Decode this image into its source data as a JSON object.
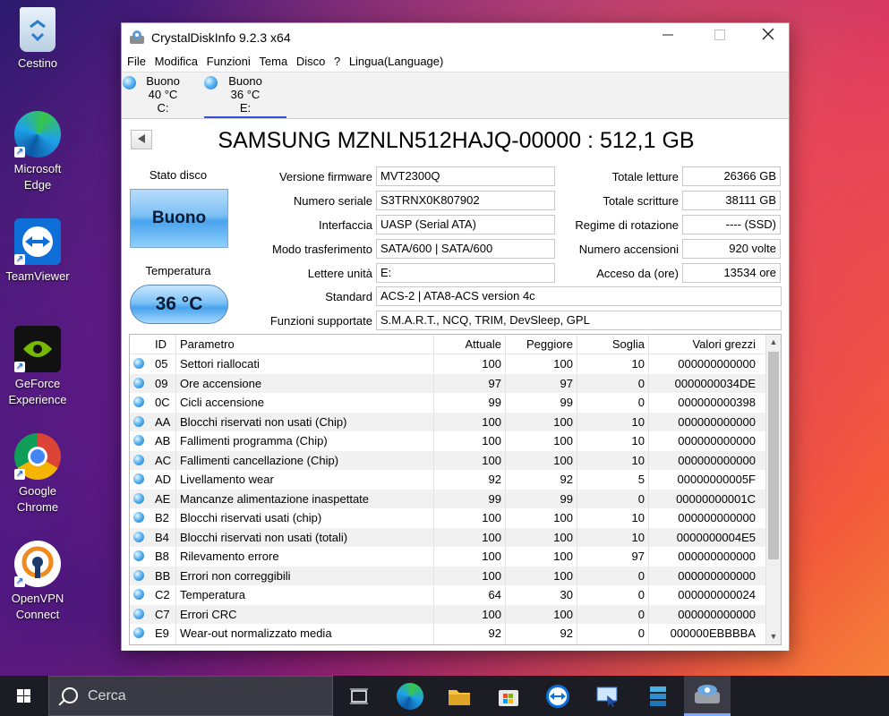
{
  "desktop": {
    "icons": [
      {
        "label": "Cestino"
      },
      {
        "label": "Microsoft Edge"
      },
      {
        "label": "TeamViewer"
      },
      {
        "label": "GeForce Experience"
      },
      {
        "label": "Google Chrome"
      },
      {
        "label": "OpenVPN Connect"
      }
    ]
  },
  "window": {
    "title": "CrystalDiskInfo 9.2.3 x64",
    "menu": [
      "File",
      "Modifica",
      "Funzioni",
      "Tema",
      "Disco",
      "?",
      "Lingua(Language)"
    ],
    "disks": [
      {
        "status": "Buono",
        "temp": "40 °C",
        "drive": "C:"
      },
      {
        "status": "Buono",
        "temp": "36 °C",
        "drive": "E:"
      }
    ],
    "disk_title": "SAMSUNG MZNLN512HAJQ-00000 : 512,1 GB",
    "status_label": "Stato disco",
    "health": "Buono",
    "temp_label": "Temperatura",
    "temp_value": "36 °C",
    "info": {
      "firmware_label": "Versione firmware",
      "firmware": "MVT2300Q",
      "serial_label": "Numero seriale",
      "serial": "S3TRNX0K807902",
      "interface_label": "Interfaccia",
      "interface": "UASP (Serial ATA)",
      "transfer_label": "Modo trasferimento",
      "transfer": "SATA/600 | SATA/600",
      "letters_label": "Lettere unità",
      "letters": "E:",
      "standard_label": "Standard",
      "standard": "ACS-2 | ATA8-ACS version 4c",
      "features_label": "Funzioni supportate",
      "features": "S.M.A.R.T., NCQ, TRIM, DevSleep, GPL",
      "reads_label": "Totale letture",
      "reads": "26366 GB",
      "writes_label": "Totale scritture",
      "writes": "38111 GB",
      "rotation_label": "Regime di rotazione",
      "rotation": "---- (SSD)",
      "power_count_label": "Numero accensioni",
      "power_count": "920 volte",
      "power_hours_label": "Acceso da (ore)",
      "power_hours": "13534 ore"
    },
    "smart": {
      "headers": {
        "id": "ID",
        "name": "Parametro",
        "current": "Attuale",
        "worst": "Peggiore",
        "threshold": "Soglia",
        "raw": "Valori grezzi"
      },
      "rows": [
        {
          "id": "05",
          "name": "Settori riallocati",
          "current": "100",
          "worst": "100",
          "threshold": "10",
          "raw": "000000000000"
        },
        {
          "id": "09",
          "name": "Ore accensione",
          "current": "97",
          "worst": "97",
          "threshold": "0",
          "raw": "0000000034DE"
        },
        {
          "id": "0C",
          "name": "Cicli accensione",
          "current": "99",
          "worst": "99",
          "threshold": "0",
          "raw": "000000000398"
        },
        {
          "id": "AA",
          "name": "Blocchi riservati non usati (Chip)",
          "current": "100",
          "worst": "100",
          "threshold": "10",
          "raw": "000000000000"
        },
        {
          "id": "AB",
          "name": "Fallimenti programma (Chip)",
          "current": "100",
          "worst": "100",
          "threshold": "10",
          "raw": "000000000000"
        },
        {
          "id": "AC",
          "name": "Fallimenti cancellazione (Chip)",
          "current": "100",
          "worst": "100",
          "threshold": "10",
          "raw": "000000000000"
        },
        {
          "id": "AD",
          "name": "Livellamento wear",
          "current": "92",
          "worst": "92",
          "threshold": "5",
          "raw": "00000000005F"
        },
        {
          "id": "AE",
          "name": "Mancanze alimentazione inaspettate",
          "current": "99",
          "worst": "99",
          "threshold": "0",
          "raw": "00000000001C"
        },
        {
          "id": "B2",
          "name": "Blocchi riservati usati (chip)",
          "current": "100",
          "worst": "100",
          "threshold": "10",
          "raw": "000000000000"
        },
        {
          "id": "B4",
          "name": "Blocchi riservati non usati (totali)",
          "current": "100",
          "worst": "100",
          "threshold": "10",
          "raw": "0000000004E5"
        },
        {
          "id": "B8",
          "name": "Rilevamento errore",
          "current": "100",
          "worst": "100",
          "threshold": "97",
          "raw": "000000000000"
        },
        {
          "id": "BB",
          "name": "Errori non correggibili",
          "current": "100",
          "worst": "100",
          "threshold": "0",
          "raw": "000000000000"
        },
        {
          "id": "C2",
          "name": "Temperatura",
          "current": "64",
          "worst": "30",
          "threshold": "0",
          "raw": "000000000024"
        },
        {
          "id": "C7",
          "name": "Errori CRC",
          "current": "100",
          "worst": "100",
          "threshold": "0",
          "raw": "000000000000"
        },
        {
          "id": "E9",
          "name": "Wear-out normalizzato media",
          "current": "92",
          "worst": "92",
          "threshold": "0",
          "raw": "000000EBBBBA"
        }
      ]
    }
  },
  "taskbar": {
    "search_placeholder": "Cerca"
  },
  "colors": {
    "health_blue": "#49a3ee",
    "active_tab_underline": "#3a4fcf"
  }
}
